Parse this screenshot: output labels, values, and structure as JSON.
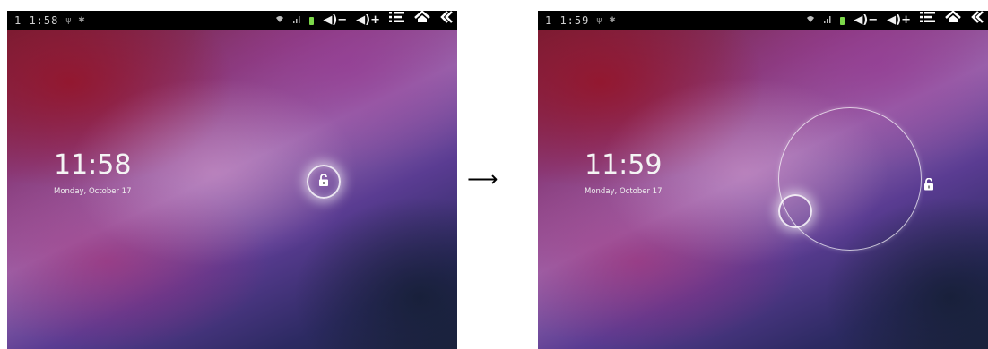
{
  "screens": [
    {
      "statusbar": {
        "time": "1 1:58",
        "volume_down": "◀)−",
        "volume_up": "◀)+",
        "menu_icon": "menu-icon",
        "home_icon": "home-icon",
        "back_icon": "back-icon"
      },
      "clock": {
        "time": "11:58",
        "date": "Monday, October 17"
      },
      "lock_icon": "unlock-icon"
    },
    {
      "statusbar": {
        "time": "1 1:59",
        "volume_down": "◀)−",
        "volume_up": "◀)+",
        "menu_icon": "menu-icon",
        "home_icon": "home-icon",
        "back_icon": "back-icon"
      },
      "clock": {
        "time": "11:59",
        "date": "Monday, October 17"
      },
      "lock_icon": "unlock-icon"
    }
  ],
  "transition_arrow": "⟶",
  "colors": {
    "statusbar": "#000000",
    "battery": "#7cd84a",
    "text": "#f4f4f4"
  }
}
